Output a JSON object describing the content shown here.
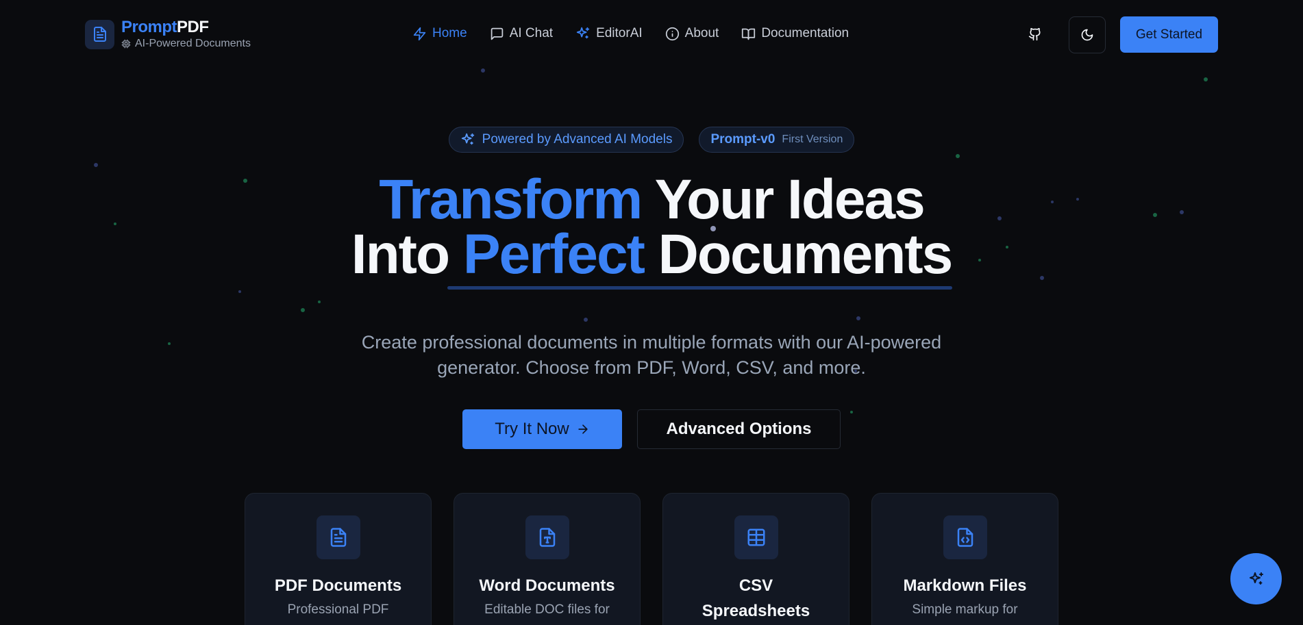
{
  "header": {
    "brand_part1": "Prompt",
    "brand_part2": "PDF",
    "brand_tagline": "AI-Powered Documents",
    "nav": [
      {
        "label": "Home",
        "icon": "zap-icon",
        "active": true
      },
      {
        "label": "AI Chat",
        "icon": "message-square-icon",
        "active": false
      },
      {
        "label": "EditorAI",
        "icon": "sparkles-icon",
        "active": false
      },
      {
        "label": "About",
        "icon": "info-icon",
        "active": false
      },
      {
        "label": "Documentation",
        "icon": "book-open-icon",
        "active": false
      }
    ],
    "github_icon": "github-icon",
    "theme_icon": "moon-icon",
    "get_started_label": "Get Started"
  },
  "hero": {
    "badge_ai": "Powered by Advanced AI Models",
    "badge_version_name": "Prompt-v0",
    "badge_version_note": "First Version",
    "headline": {
      "l1_accent": "Transform",
      "l1_rest": " Your Ideas",
      "l2_start": "Into ",
      "l2_accent": "Perfect",
      "l2_rest": " Documents"
    },
    "subtitle_line1": "Create professional documents in multiple formats with our AI-powered",
    "subtitle_line2": "generator. Choose from PDF, Word, CSV, and more.",
    "cta_primary": "Try It Now",
    "cta_secondary": "Advanced Options"
  },
  "cards": [
    {
      "title": "PDF Documents",
      "desc": "Professional PDF",
      "icon": "file-text-icon"
    },
    {
      "title": "Word Documents",
      "desc": "Editable DOC files for",
      "icon": "file-type-icon"
    },
    {
      "title": "CSV Spreadsheets",
      "desc": "",
      "icon": "table-icon"
    },
    {
      "title": "Markdown Files",
      "desc": "Simple markup for",
      "icon": "file-code-icon"
    }
  ],
  "colors": {
    "accent": "#3b82f6",
    "background": "#0a0b0e",
    "card": "#121722"
  }
}
